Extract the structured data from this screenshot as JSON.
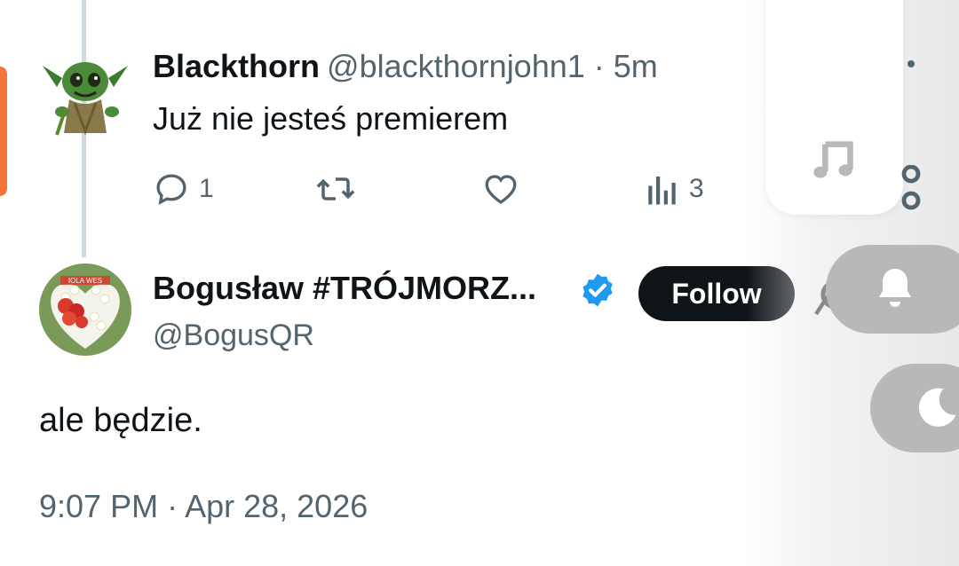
{
  "reply": {
    "display_name": "Blackthorn",
    "handle_time": "@blackthornjohn1 · 5m",
    "text": "Już nie jesteś premierem",
    "reply_count": "1",
    "views_count": "3"
  },
  "main": {
    "display_name": "Bogusław #TRÓJMORZ...",
    "handle": "@BogusQR",
    "follow_label": "Follow",
    "text": "ale będzie.",
    "timestamp": "9:07 PM · Apr 28, 2026",
    "avatar_caption": "IOLA WES"
  },
  "icons": {
    "reply": "comment-icon",
    "retweet": "retweet-icon",
    "like": "heart-icon",
    "views": "views-icon",
    "verified": "verified-badge-icon",
    "grok": "grok-icon",
    "music": "music-note-icon",
    "share": "share-icon",
    "bell": "bell-icon",
    "moon": "moon-icon"
  },
  "colors": {
    "text_primary": "#0f1419",
    "text_secondary": "#536471",
    "verified_blue": "#1d9bf0",
    "follow_bg": "#0f1419",
    "thread_line": "#cfd9de",
    "overlay_gray": "#b8b8b8"
  }
}
